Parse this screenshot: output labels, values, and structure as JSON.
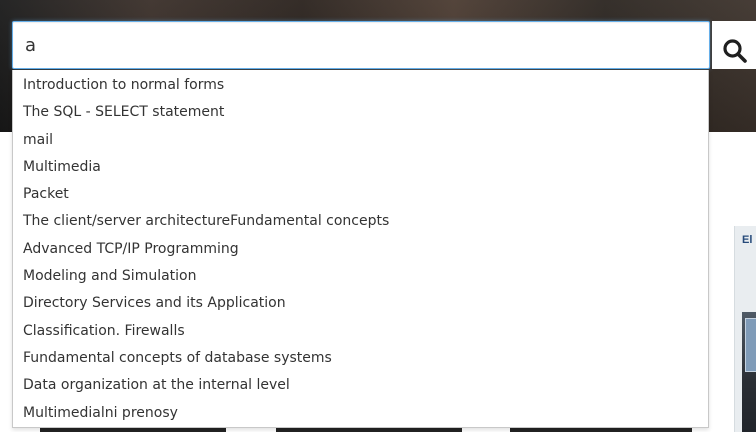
{
  "search": {
    "query": "a",
    "button_icon": "search-icon"
  },
  "suggestions": [
    "Introduction to normal forms",
    "The SQL - SELECT statement",
    "mail",
    "Multimedia",
    "Packet",
    "The client/server architectureFundamental concepts",
    "Advanced TCP/IP Programming",
    "Modeling and Simulation",
    "Directory Services and its Application",
    "Classification. Firewalls",
    "Fundamental concepts of database systems",
    "Data organization at the internal level",
    "Multimedialni prenosy"
  ],
  "side_card": {
    "title_fragment": "El"
  },
  "colors": {
    "input_focus_border": "#66afe9",
    "text": "#333333",
    "side_card_title": "#264a7a"
  }
}
